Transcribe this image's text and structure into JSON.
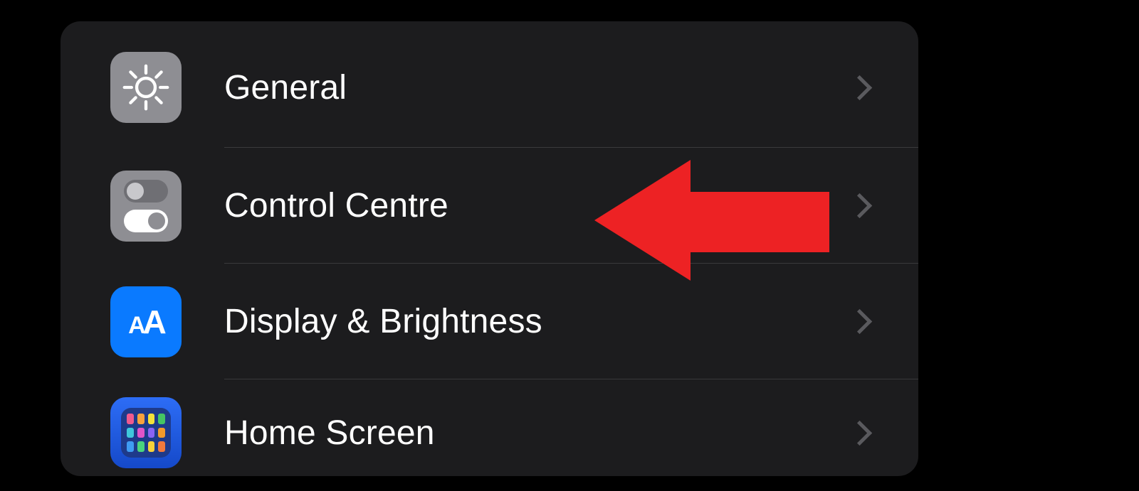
{
  "settings": {
    "items": [
      {
        "label": "General",
        "icon": "gear-icon",
        "icon_bg": "grey"
      },
      {
        "label": "Control Centre",
        "icon": "toggles-icon",
        "icon_bg": "grey"
      },
      {
        "label": "Display & Brightness",
        "icon": "text-size-icon",
        "icon_bg": "blue"
      },
      {
        "label": "Home Screen",
        "icon": "app-grid-icon",
        "icon_bg": "blue"
      }
    ]
  },
  "annotation": {
    "type": "arrow",
    "points_to_item_index": 1,
    "color": "#ed2224"
  },
  "homegrid_colors": [
    "#f05a8e",
    "#f8a23d",
    "#f3e13a",
    "#45c463",
    "#3fc8dc",
    "#e055c9",
    "#8a63f4",
    "#f39a2b",
    "#3f9cf2",
    "#4ad47d",
    "#f7d23a",
    "#f17a3c"
  ]
}
